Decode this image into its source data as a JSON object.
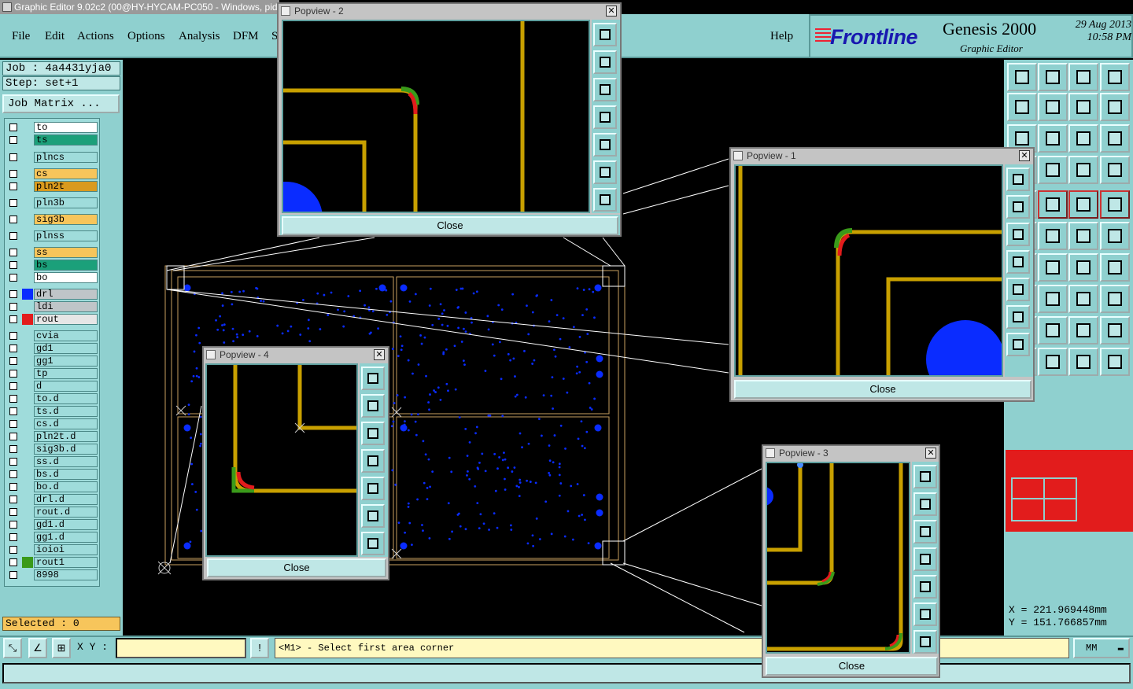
{
  "window_title": "Graphic Editor 9.02c2 (00@HY-HYCAM-PC050 - Windows, pid",
  "menu": [
    "File",
    "Edit",
    "Actions",
    "Options",
    "Analysis",
    "DFM",
    "S"
  ],
  "help_label": "Help",
  "brand": {
    "logo": "Frontline",
    "product": "Genesis 2000",
    "subtitle": "Graphic Editor",
    "date": "29 Aug 2013",
    "time": "10:58 PM"
  },
  "job": "Job : 4a4431yja0",
  "step": "Step: set+1",
  "job_matrix": "Job Matrix ...",
  "layers": [
    {
      "name": "to",
      "swatch": "",
      "fill": "#ffffff"
    },
    {
      "name": "ts",
      "swatch": "",
      "fill": "#1ba07a"
    },
    {
      "name": "plncs",
      "swatch": "",
      "fill": "#9fdcdb"
    },
    {
      "name": "cs",
      "swatch": "",
      "fill": "#f7c55b"
    },
    {
      "name": "pln2t",
      "swatch": "",
      "fill": "#d99a1e"
    },
    {
      "name": "pln3b",
      "swatch": "",
      "fill": "#9fdcdb"
    },
    {
      "name": "sig3b",
      "swatch": "",
      "fill": "#f7c55b"
    },
    {
      "name": "plnss",
      "swatch": "",
      "fill": "#9fdcdb"
    },
    {
      "name": "ss",
      "swatch": "",
      "fill": "#f7c55b"
    },
    {
      "name": "bs",
      "swatch": "",
      "fill": "#1ba07a"
    },
    {
      "name": "bo",
      "swatch": "",
      "fill": "#ffffff"
    },
    {
      "name": "drl",
      "swatch": "#0a2cff",
      "fill": "#bfc5c8"
    },
    {
      "name": "ldi",
      "swatch": "",
      "fill": "#bfc5c8"
    },
    {
      "name": "rout",
      "swatch": "#e21c1c",
      "fill": "#e6e6e6"
    },
    {
      "name": "cvia",
      "swatch": "",
      "fill": "#9fdcdb"
    },
    {
      "name": "gd1",
      "swatch": "",
      "fill": "#9fdcdb"
    },
    {
      "name": "gg1",
      "swatch": "",
      "fill": "#9fdcdb"
    },
    {
      "name": "tp",
      "swatch": "",
      "fill": "#9fdcdb"
    },
    {
      "name": "d",
      "swatch": "",
      "fill": "#9fdcdb"
    },
    {
      "name": "to.d",
      "swatch": "",
      "fill": "#9fdcdb"
    },
    {
      "name": "ts.d",
      "swatch": "",
      "fill": "#9fdcdb"
    },
    {
      "name": "cs.d",
      "swatch": "",
      "fill": "#9fdcdb"
    },
    {
      "name": "pln2t.d",
      "swatch": "",
      "fill": "#9fdcdb"
    },
    {
      "name": "sig3b.d",
      "swatch": "",
      "fill": "#9fdcdb"
    },
    {
      "name": "ss.d",
      "swatch": "",
      "fill": "#9fdcdb"
    },
    {
      "name": "bs.d",
      "swatch": "",
      "fill": "#9fdcdb"
    },
    {
      "name": "bo.d",
      "swatch": "",
      "fill": "#9fdcdb"
    },
    {
      "name": "drl.d",
      "swatch": "",
      "fill": "#9fdcdb"
    },
    {
      "name": "rout.d",
      "swatch": "",
      "fill": "#9fdcdb"
    },
    {
      "name": "gd1.d",
      "swatch": "",
      "fill": "#9fdcdb"
    },
    {
      "name": "gg1.d",
      "swatch": "",
      "fill": "#9fdcdb"
    },
    {
      "name": "ioioi",
      "swatch": "",
      "fill": "#9fdcdb"
    },
    {
      "name": "rout1",
      "swatch": "#3a9a1a",
      "fill": "#9fdcdb"
    },
    {
      "name": "8998",
      "swatch": "",
      "fill": "#9fdcdb"
    }
  ],
  "selected": "Selected : 0",
  "xy_label": "X Y :",
  "prompt": "<M1> - Select first area corner",
  "units": "MM",
  "coords": {
    "x": "X = 221.969448mm",
    "y": "Y = 151.766857mm"
  },
  "popups": [
    {
      "title": "Popview - 2",
      "close": "Close"
    },
    {
      "title": "Popview - 1",
      "close": "Close"
    },
    {
      "title": "Popview - 4",
      "close": "Close"
    },
    {
      "title": "Popview - 3",
      "close": "Close"
    }
  ],
  "colors": {
    "panel": "#8fd0cf",
    "trace": "#c8a000",
    "pad": "#0a2cff",
    "rout": "#e21c1c",
    "green": "#3a9a1a"
  }
}
